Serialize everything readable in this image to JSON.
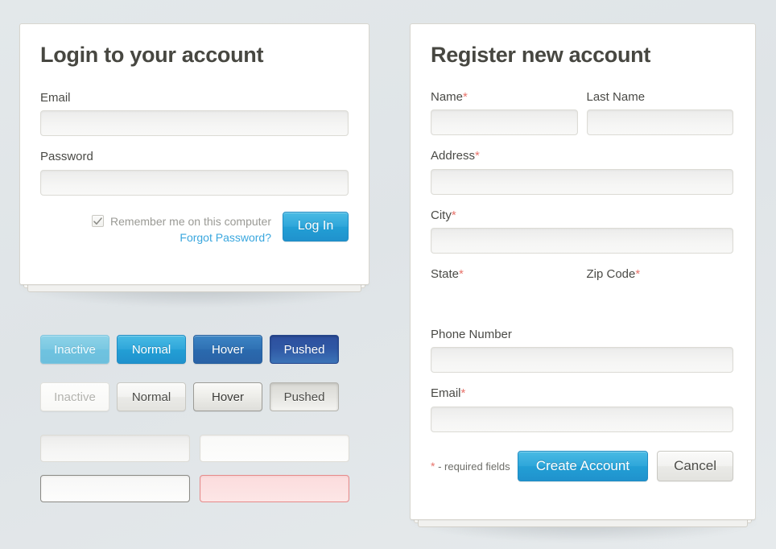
{
  "login": {
    "title": "Login to your account",
    "email": {
      "label": "Email",
      "value": "",
      "placeholder": ""
    },
    "password": {
      "label": "Password",
      "value": "",
      "placeholder": ""
    },
    "remember_label": "Remember me on this computer",
    "remember_checked": true,
    "forgot_link": "Forgot Password?",
    "submit_label": "Log In"
  },
  "register": {
    "title": "Register new account",
    "required_marker": "*",
    "fields": {
      "name": {
        "label": "Name",
        "required": true,
        "value": ""
      },
      "last_name": {
        "label": "Last Name",
        "required": false,
        "value": ""
      },
      "address": {
        "label": "Address",
        "required": true,
        "value": ""
      },
      "city": {
        "label": "City",
        "required": true,
        "value": ""
      },
      "state": {
        "label": "State",
        "required": true,
        "value": ""
      },
      "zip": {
        "label": "Zip Code",
        "required": true,
        "value": ""
      },
      "phone": {
        "label": "Phone Number",
        "required": false,
        "value": ""
      },
      "email": {
        "label": "Email",
        "required": true,
        "value": ""
      }
    },
    "required_note": " - required fields",
    "create_label": "Create Account",
    "cancel_label": "Cancel"
  },
  "swatches": {
    "blue_buttons": [
      {
        "label": "Inactive",
        "state": "inactive"
      },
      {
        "label": "Normal",
        "state": "normal"
      },
      {
        "label": "Hover",
        "state": "hover"
      },
      {
        "label": "Pushed",
        "state": "pushed"
      }
    ],
    "gray_buttons": [
      {
        "label": "Inactive",
        "state": "inactive"
      },
      {
        "label": "Normal",
        "state": "normal"
      },
      {
        "label": "Hover",
        "state": "hover"
      },
      {
        "label": "Pushed",
        "state": "pushed"
      }
    ],
    "inputs": [
      {
        "state": "disabled",
        "value": ""
      },
      {
        "state": "normal",
        "value": ""
      },
      {
        "state": "focus",
        "value": ""
      },
      {
        "state": "error",
        "value": ""
      }
    ]
  },
  "colors": {
    "page_background": "#dfe4e7",
    "card_background": "#ffffff",
    "card_border": "#d8d6cf",
    "heading": "#474741",
    "label": "#4a4a46",
    "accent_blue": "#2fa6da",
    "link_blue": "#3aa7de",
    "required_red": "#e8736b",
    "error_border": "#e58a8a",
    "error_fill": "#fbdcdd",
    "muted_text": "#9a9a95",
    "input_fill": "#f5f5f4",
    "input_border": "#dcdbd5"
  }
}
